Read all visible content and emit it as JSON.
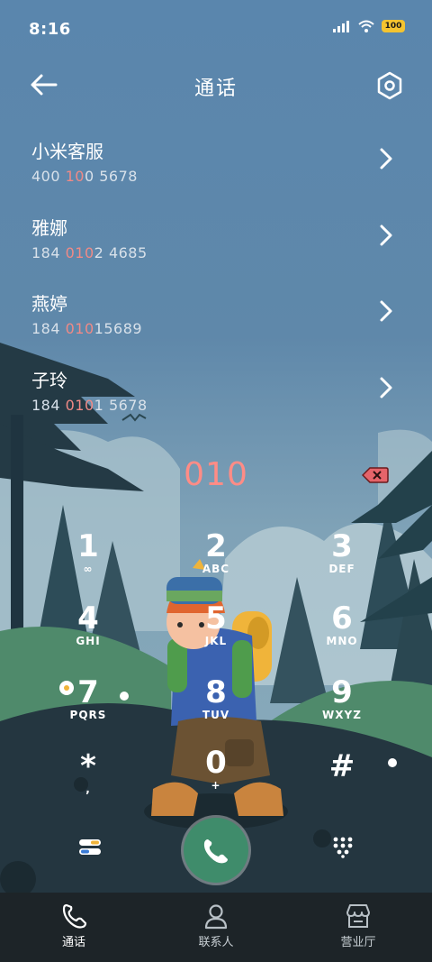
{
  "status": {
    "time": "8:16",
    "battery": "100"
  },
  "header": {
    "title": "通话"
  },
  "contacts": [
    {
      "name": "小米客服",
      "num_a": "400 ",
      "num_hl": "10",
      "num_b": "0 5678"
    },
    {
      "name": "雅娜",
      "num_a": "184 ",
      "num_hl": "010",
      "num_b": "2 4685"
    },
    {
      "name": "燕婷",
      "num_a": "184 ",
      "num_hl": "010",
      "num_b": "15689"
    },
    {
      "name": "子玲",
      "num_a": "184 ",
      "num_hl": "010",
      "num_b": "1 5678"
    }
  ],
  "dial": {
    "value": "010"
  },
  "keypad": [
    {
      "digit": "1",
      "letters": "∞"
    },
    {
      "digit": "2",
      "letters": "ABC"
    },
    {
      "digit": "3",
      "letters": "DEF"
    },
    {
      "digit": "4",
      "letters": "GHI"
    },
    {
      "digit": "5",
      "letters": "JKL"
    },
    {
      "digit": "6",
      "letters": "MNO"
    },
    {
      "digit": "7",
      "letters": "PQRS"
    },
    {
      "digit": "8",
      "letters": "TUV"
    },
    {
      "digit": "9",
      "letters": "WXYZ"
    },
    {
      "digit": "*",
      "letters": ","
    },
    {
      "digit": "0",
      "letters": "+"
    },
    {
      "digit": "#",
      "letters": ""
    }
  ],
  "tabs": [
    {
      "label": "通话",
      "icon": "phone-icon",
      "active": true
    },
    {
      "label": "联系人",
      "icon": "person-icon",
      "active": false
    },
    {
      "label": "营业厅",
      "icon": "store-icon",
      "active": false
    }
  ],
  "colors": {
    "highlight": "#f08a86",
    "call_button": "#3f8c6b",
    "tabbar": "#1d2428"
  }
}
